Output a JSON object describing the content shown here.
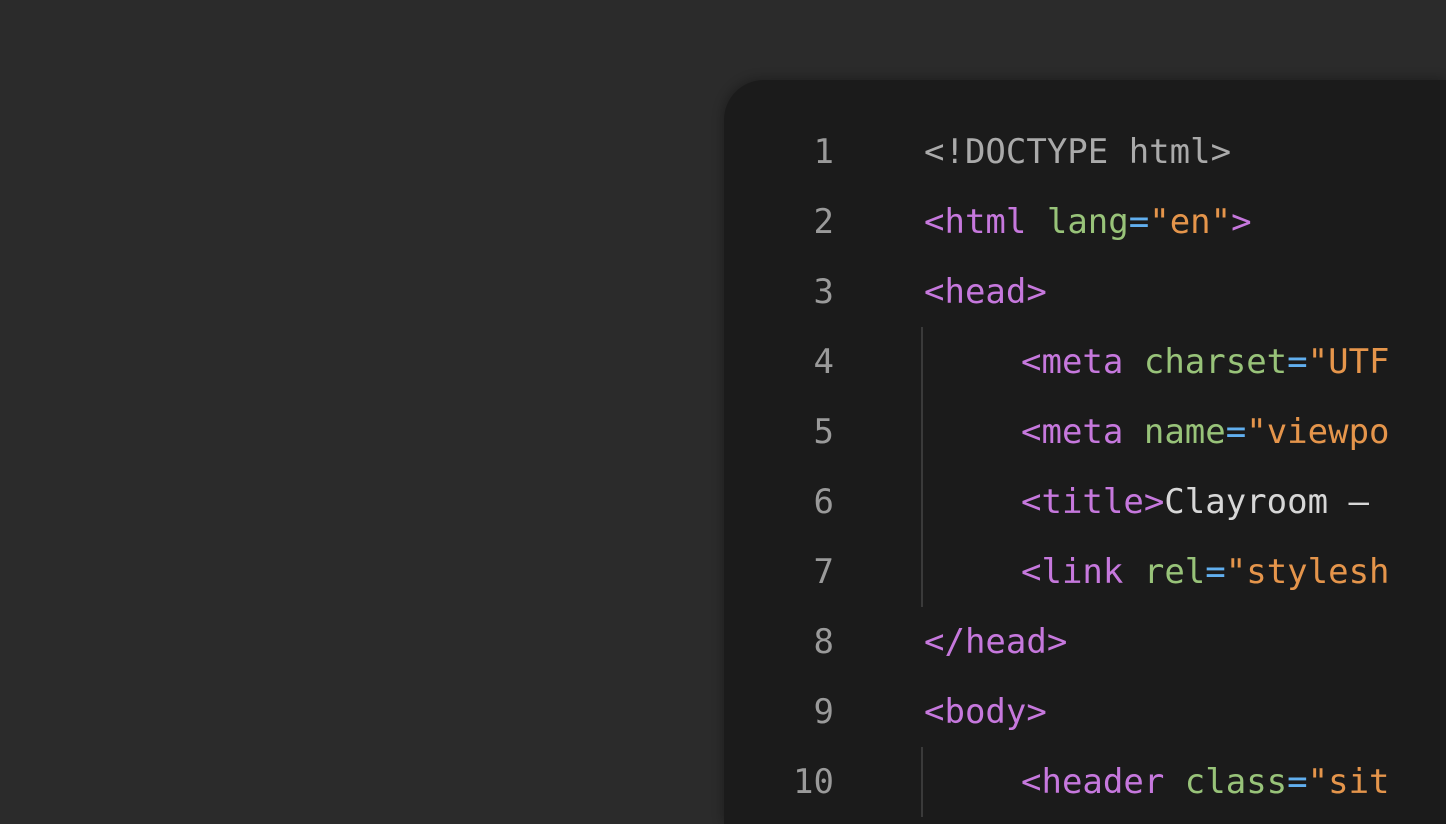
{
  "colors": {
    "background": "#2b2b2b",
    "editor": "#1b1b1b",
    "line_number": "#9a9a9a",
    "tag": "#c678dd",
    "attribute": "#98c379",
    "string": "#e5954b",
    "punct": "#61afef",
    "doctype": "#aaaaaa",
    "text": "#d7d7d7"
  },
  "editor": {
    "lines": [
      {
        "num": "1",
        "tokens": [
          {
            "t": "<!DOCTYPE html>",
            "k": "doctype"
          }
        ]
      },
      {
        "num": "2",
        "tokens": [
          {
            "t": "<html",
            "k": "tag"
          },
          {
            "t": " ",
            "k": "text"
          },
          {
            "t": "lang",
            "k": "attribute"
          },
          {
            "t": "=",
            "k": "punct"
          },
          {
            "t": "\"en\"",
            "k": "string"
          },
          {
            "t": ">",
            "k": "tag"
          }
        ]
      },
      {
        "num": "3",
        "tokens": [
          {
            "t": "<head>",
            "k": "tag"
          }
        ]
      },
      {
        "num": "4",
        "indent": true,
        "tokens": [
          {
            "t": "<meta",
            "k": "tag"
          },
          {
            "t": " ",
            "k": "text"
          },
          {
            "t": "charset",
            "k": "attribute"
          },
          {
            "t": "=",
            "k": "punct"
          },
          {
            "t": "\"UTF",
            "k": "string"
          }
        ]
      },
      {
        "num": "5",
        "indent": true,
        "tokens": [
          {
            "t": "<meta",
            "k": "tag"
          },
          {
            "t": " ",
            "k": "text"
          },
          {
            "t": "name",
            "k": "attribute"
          },
          {
            "t": "=",
            "k": "punct"
          },
          {
            "t": "\"viewpo",
            "k": "string"
          }
        ]
      },
      {
        "num": "6",
        "indent": true,
        "tokens": [
          {
            "t": "<title>",
            "k": "tag"
          },
          {
            "t": "Clayroom – ",
            "k": "text"
          }
        ]
      },
      {
        "num": "7",
        "indent": true,
        "tokens": [
          {
            "t": "<link",
            "k": "tag"
          },
          {
            "t": " ",
            "k": "text"
          },
          {
            "t": "rel",
            "k": "attribute"
          },
          {
            "t": "=",
            "k": "punct"
          },
          {
            "t": "\"stylesh",
            "k": "string"
          }
        ]
      },
      {
        "num": "8",
        "tokens": [
          {
            "t": "</head>",
            "k": "tag"
          }
        ]
      },
      {
        "num": "9",
        "tokens": [
          {
            "t": "<body>",
            "k": "tag"
          }
        ]
      },
      {
        "num": "10",
        "indent": true,
        "tokens": [
          {
            "t": "<header",
            "k": "tag"
          },
          {
            "t": " ",
            "k": "text"
          },
          {
            "t": "class",
            "k": "attribute"
          },
          {
            "t": "=",
            "k": "punct"
          },
          {
            "t": "\"sit",
            "k": "string"
          }
        ]
      }
    ]
  }
}
